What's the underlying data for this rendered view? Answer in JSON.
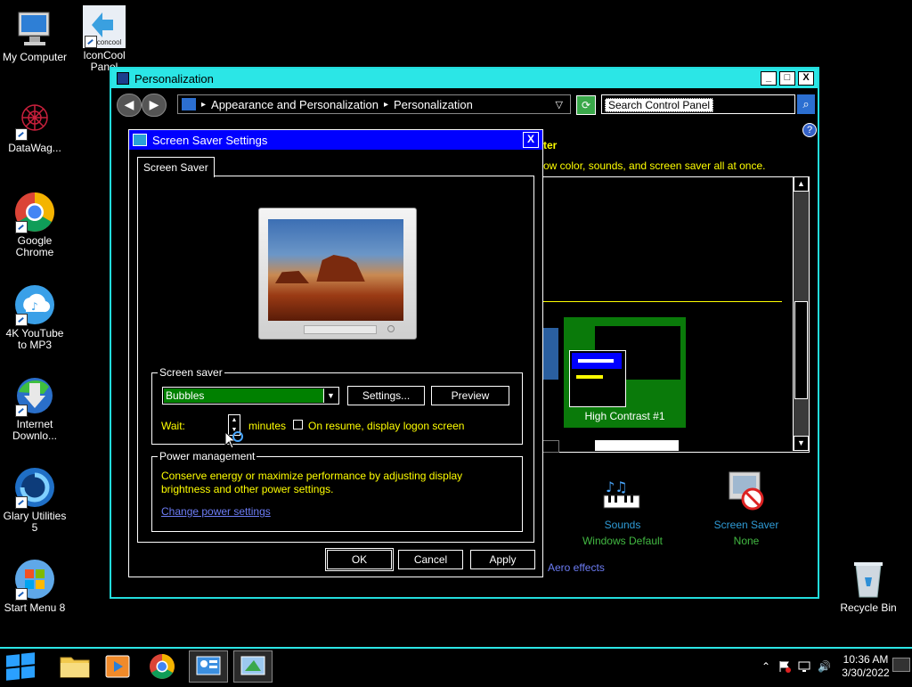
{
  "desktop": {
    "icons": [
      {
        "label": "My Computer",
        "icon": "computer-icon"
      },
      {
        "label": "IconCool Panel",
        "icon": "iconcool-icon",
        "tag": "iconcool"
      },
      {
        "label": "DataWag...",
        "icon": "datawag-icon"
      },
      {
        "label": "Google Chrome",
        "icon": "chrome-icon"
      },
      {
        "label": "4K YouTube to MP3",
        "icon": "youtube-mp3-icon"
      },
      {
        "label": "Internet Downlo...",
        "icon": "idm-icon"
      },
      {
        "label": "Glary Utilities 5",
        "icon": "glary-icon"
      },
      {
        "label": "Start Menu 8",
        "icon": "startmenu8-icon"
      },
      {
        "label": "Recycle Bin",
        "icon": "recycle-bin-icon"
      }
    ]
  },
  "cpwindow": {
    "title": "Personalization",
    "controls": {
      "minimize": "_",
      "maximize": "□",
      "close": "X"
    },
    "nav": {
      "back": "◀",
      "forward": "▶"
    },
    "breadcrumb": [
      "Appearance and Personalization",
      "Personalization"
    ],
    "breadcrumb_sep": "▸",
    "dropdown_arrow": "▽",
    "search_placeholder": "Search Control Panel",
    "help": "?",
    "heading_fragment": "ter",
    "description_fragment": "ow color, sounds, and screen saver all at once.",
    "theme_tile": {
      "label": "High Contrast #1",
      "colors": {
        "bg": "#0a7a0a",
        "title": "#0000ff",
        "text": "#ffff00"
      }
    },
    "scroll_up": "▲",
    "scroll_down": "▼",
    "bottom_items": [
      {
        "name": "Sounds",
        "value": "Windows Default",
        "icon": "sounds-icon"
      },
      {
        "name": "Screen Saver",
        "value": "None",
        "icon": "screen-saver-icon"
      }
    ],
    "aero_link": "Aero effects"
  },
  "dialog": {
    "title": "Screen Saver Settings",
    "close": "X",
    "tab": "Screen Saver",
    "screen_saver_group": "Screen saver",
    "selected_saver": "Bubbles",
    "settings_button": "Settings...",
    "preview_button": "Preview",
    "wait_label": "Wait:",
    "wait_minutes": "",
    "minutes_label": "minutes",
    "resume_label": "On resume, display logon screen",
    "resume_checked": false,
    "power_group": "Power management",
    "power_desc": "Conserve energy or maximize performance by adjusting display brightness and other power settings.",
    "power_link": "Change power settings",
    "ok": "OK",
    "cancel": "Cancel",
    "apply": "Apply"
  },
  "taskbar": {
    "apps": [
      "file-explorer-icon",
      "media-player-icon",
      "chrome-icon",
      "control-panel-icon",
      "personalization-icon"
    ],
    "tray": {
      "chevron": "⌃",
      "volume": "🔊"
    },
    "time": "10:36 AM",
    "date": "3/30/2022"
  },
  "colors": {
    "accent": "#2be6e6",
    "dialog_title": "#0000ff",
    "text_yellow": "#ffff00",
    "link": "#6c7cf4",
    "selection": "#008000"
  }
}
